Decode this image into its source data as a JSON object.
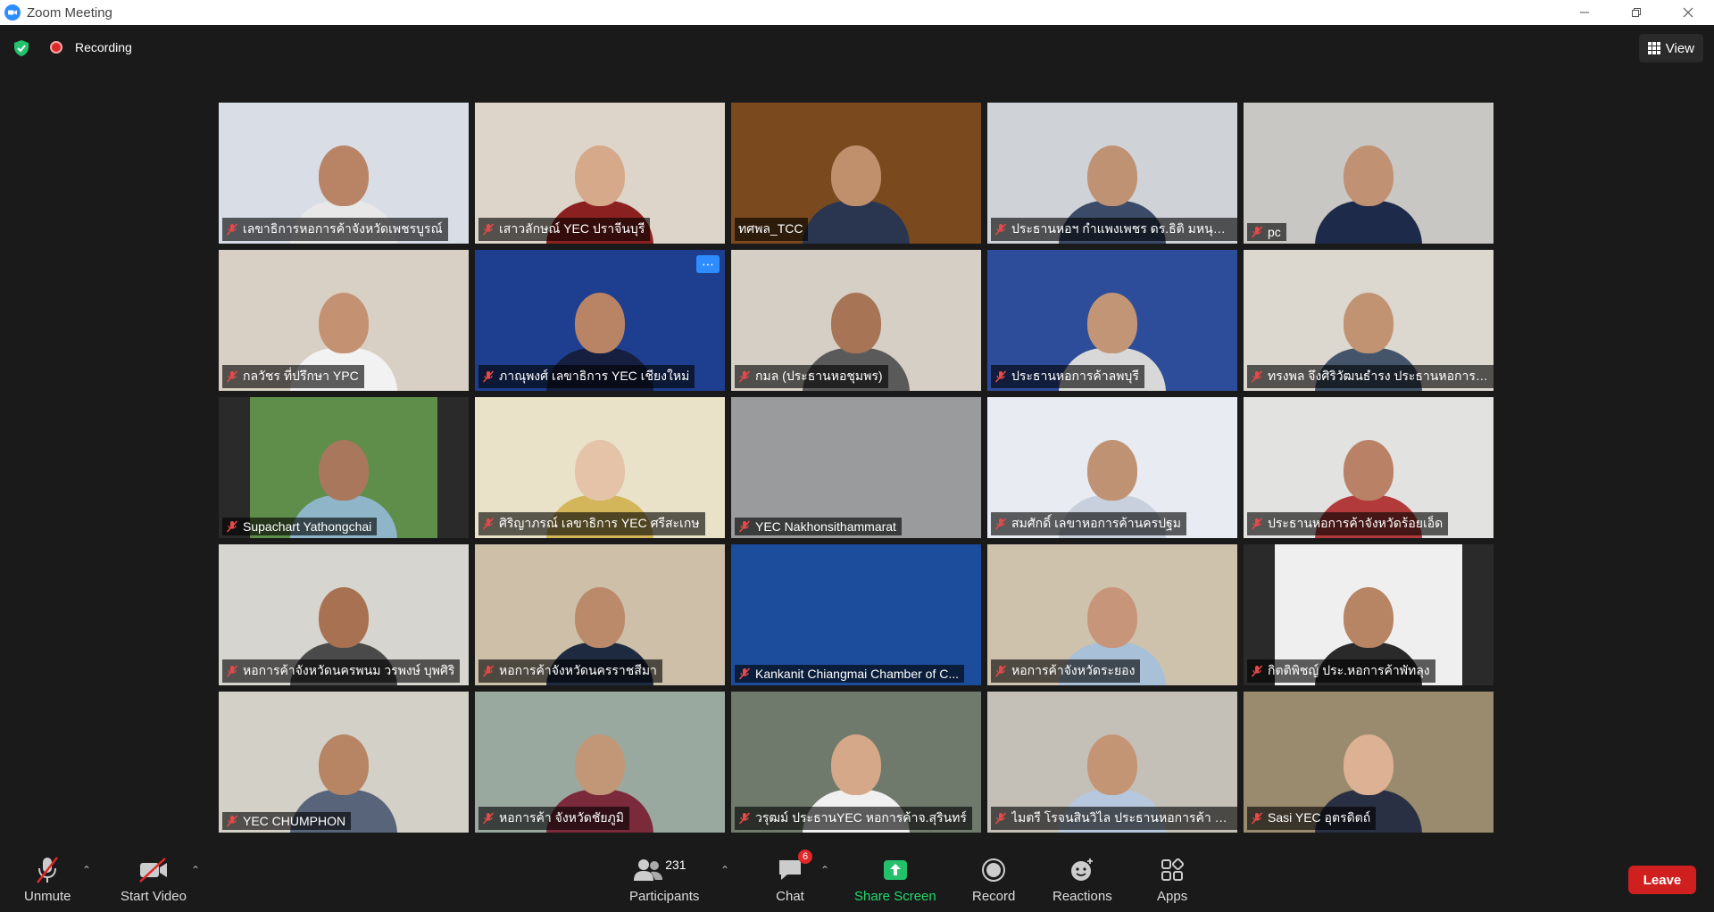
{
  "window": {
    "title": "Zoom Meeting"
  },
  "topbar": {
    "recording_label": "Recording",
    "view_label": "View"
  },
  "participants_grid": [
    {
      "name": "เลขาธิการหอการค้าจังหวัดเพชรบูรณ์",
      "bg": "#d9dde6",
      "skin": "#b98466",
      "shirt": "#e8e8e8"
    },
    {
      "name": "เสาวลักษณ์ YEC ปราจีนบุรี",
      "bg": "#ddd5c9",
      "skin": "#d6a98a",
      "shirt": "#8b2020"
    },
    {
      "name": "ทศพล_TCC",
      "bg": "#7a4a1e",
      "skin": "#c0906c",
      "shirt": "#2a3550",
      "active": true
    },
    {
      "name": "ประธานหอฯ กำแพงเพชร ดร.ธิติ มหนุญ...",
      "bg": "#cfd3d8",
      "skin": "#c09274",
      "shirt": "#3b4a66"
    },
    {
      "name": "pc",
      "bg": "#c9c7c3",
      "skin": "#c19173",
      "shirt": "#1e2a4a"
    },
    {
      "name": "กลวัชร ที่ปรึกษา YPC",
      "bg": "#d8d0c4",
      "skin": "#c49272",
      "shirt": "#f2f2f2"
    },
    {
      "name": "ภาณุพงศ์ เลขาธิการ YEC เชียงใหม่",
      "bg": "#1e3f8f",
      "skin": "#b98466",
      "shirt": "#161f40",
      "more": true
    },
    {
      "name": "กมล (ประธานหอชุมพร)",
      "bg": "#d5cfc6",
      "skin": "#a87456",
      "shirt": "#5a5a5a"
    },
    {
      "name": "ประธานหอการค้าลพบุรี",
      "bg": "#2d4d9a",
      "skin": "#c29576",
      "shirt": "#d8d8d8"
    },
    {
      "name": "ทรงพล จึงศิริวัฒนธำรง ประธานหอการค้...",
      "bg": "#dcd7cf",
      "skin": "#c19373",
      "shirt": "#44556b"
    },
    {
      "name": "Supachart Yathongchai",
      "bg": "#5f8d4a",
      "skin": "#a9785c",
      "shirt": "#8fb6c8",
      "narrow": true
    },
    {
      "name": "ศิริญาภรณ์ เลขาธิการ YEC ศรีสะเกษ",
      "bg": "#e9e2c9",
      "skin": "#e4c3a8",
      "shirt": "#d3b55a"
    },
    {
      "name": "YEC Nakhonsithammarat",
      "bg": "#9a9b9c",
      "skin": "#9a9b9c",
      "shirt": "#8c8d8e",
      "empty": true
    },
    {
      "name": "สมศักดิ์ เลขาหอการค้านครปฐม",
      "bg": "#e8ecf2",
      "skin": "#c09274",
      "shirt": "#c7d0dc"
    },
    {
      "name": "ประธานหอการค้าจังหวัดร้อยเอ็ด",
      "bg": "#e2e2e0",
      "skin": "#b98266",
      "shirt": "#b23a3a"
    },
    {
      "name": "หอการค้าจังหวัดนครพนม วรพงษ์ บุพศิริ",
      "bg": "#d7d5cf",
      "skin": "#a87252",
      "shirt": "#4a4a4a"
    },
    {
      "name": "หอการค้าจังหวัดนครราชสีมา",
      "bg": "#cdbfa8",
      "skin": "#bb8a6a",
      "shirt": "#1e2a40"
    },
    {
      "name": "Kankanit Chiangmai Chamber of C...",
      "bg": "#1c4d9c",
      "skin": "#1c4d9c",
      "shirt": "#1c4d9c",
      "empty": true
    },
    {
      "name": "หอการค้าจังหวัดระยอง",
      "bg": "#cfc2ac",
      "skin": "#c7957a",
      "shirt": "#a8c0d8"
    },
    {
      "name": "กิตติพิชญ์ ประ.หอการค้าพัทลุง",
      "bg": "#efefef",
      "skin": "#b78464",
      "shirt": "#2a2a2a",
      "narrow": true
    },
    {
      "name": "YEC CHUMPHON",
      "bg": "#d3d0c8",
      "skin": "#b88564",
      "shirt": "#58647a"
    },
    {
      "name": "หอการค้า จังหวัดชัยภูมิ",
      "bg": "#9aa9a0",
      "skin": "#c29777",
      "shirt": "#7a2a3a"
    },
    {
      "name": "วรุฒม์ ประธานYEC หอการค้าจ.สุรินทร์",
      "bg": "#6f7a6c",
      "skin": "#d4a888",
      "shirt": "#f0f0f0"
    },
    {
      "name": "ไมตรี โรจนสินวิไล ประธานหอการค้า จัง...",
      "bg": "#c4c0b8",
      "skin": "#c49575",
      "shirt": "#b7c8de"
    },
    {
      "name": "Sasi YEC อุตรดิตถ์",
      "bg": "#9a8a6e",
      "skin": "#dcb194",
      "shirt": "#2a3044"
    }
  ],
  "toolbar": {
    "unmute": "Unmute",
    "start_video": "Start Video",
    "participants": "Participants",
    "participants_count": "231",
    "chat": "Chat",
    "chat_badge": "6",
    "share_screen": "Share Screen",
    "record": "Record",
    "reactions": "Reactions",
    "apps": "Apps",
    "leave": "Leave"
  }
}
